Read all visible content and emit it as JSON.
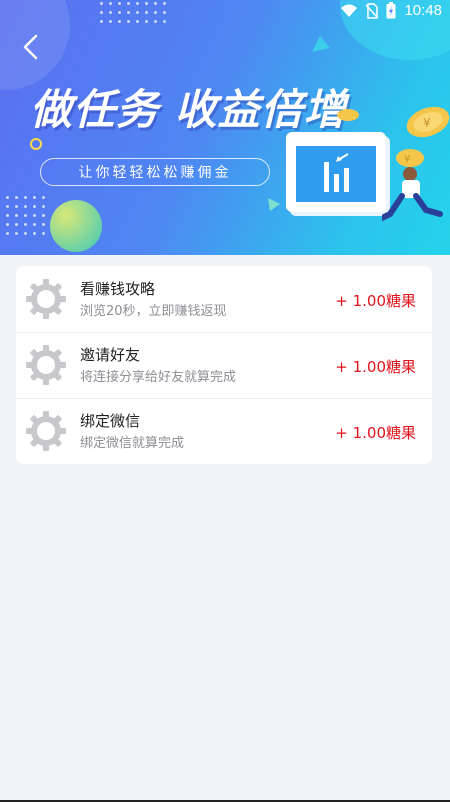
{
  "status_bar": {
    "time": "10:48",
    "icons": [
      "wifi-icon",
      "no-sim-icon",
      "battery-charging-icon"
    ]
  },
  "header": {
    "back_icon": "chevron-left-icon",
    "title": "做任务 收益倍增",
    "subtitle": "让你轻轻松松赚佣金"
  },
  "tasks": [
    {
      "icon": "gear-icon",
      "title": "看赚钱攻略",
      "desc": "浏览20秒，立即赚钱返现",
      "reward": "+ 1.00糖果"
    },
    {
      "icon": "gear-icon",
      "title": "邀请好友",
      "desc": "将连接分享给好友就算完成",
      "reward": "+ 1.00糖果"
    },
    {
      "icon": "gear-icon",
      "title": "绑定微信",
      "desc": "绑定微信就算完成",
      "reward": "+ 1.00糖果"
    }
  ],
  "colors": {
    "reward": "#e0141c",
    "gear": "#c8c8cc",
    "hero_start": "#5a6ff0",
    "hero_end": "#25d3ea"
  }
}
